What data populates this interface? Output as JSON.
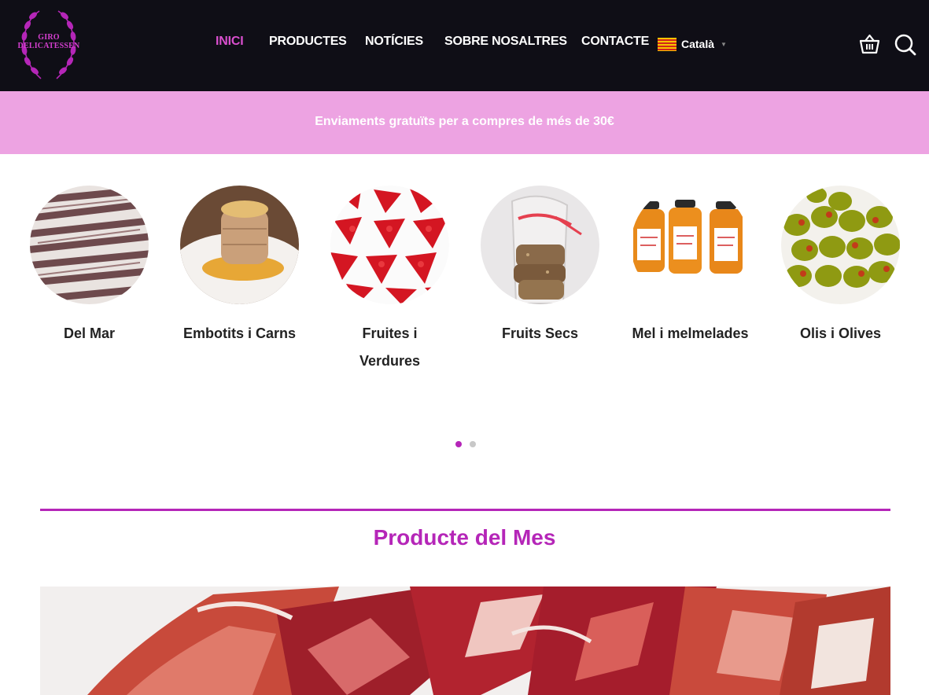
{
  "brand": {
    "line1": "GIRO",
    "line2": "DELICATESSEN"
  },
  "nav": {
    "items": [
      {
        "label": "INICI",
        "active": true
      },
      {
        "label": "PRODUCTES",
        "active": false
      },
      {
        "label": "NOTÍCIES",
        "active": false
      },
      {
        "label": "SOBRE NOSALTRES",
        "active": false
      },
      {
        "label": "CONTACTE",
        "active": false
      }
    ],
    "language": "Català"
  },
  "icons": {
    "cart": "basket-icon",
    "search": "search-icon",
    "flag": "catalan-flag-icon"
  },
  "banner": {
    "text": "Enviaments gratuïts per a compres de més de 30€"
  },
  "categories": [
    {
      "label": "Del Mar",
      "image": "anchovies"
    },
    {
      "label": "Embotits i Carns",
      "image": "foie-gras"
    },
    {
      "label": "Fruites i Verdures",
      "image": "red-peppers"
    },
    {
      "label": "Fruits Secs",
      "image": "biscuits-bag"
    },
    {
      "label": "Mel i melmelades",
      "image": "jam-jars"
    },
    {
      "label": "Olis i Olives",
      "image": "green-olives"
    }
  ],
  "carousel": {
    "pages": 2,
    "current": 1
  },
  "section": {
    "title": "Producte del Mes",
    "image": "sliced-ham"
  },
  "colors": {
    "accent": "#b526b8",
    "header_bg": "#0f0e16",
    "banner_bg": "#eda3e2",
    "nav_active": "#d94fce"
  }
}
